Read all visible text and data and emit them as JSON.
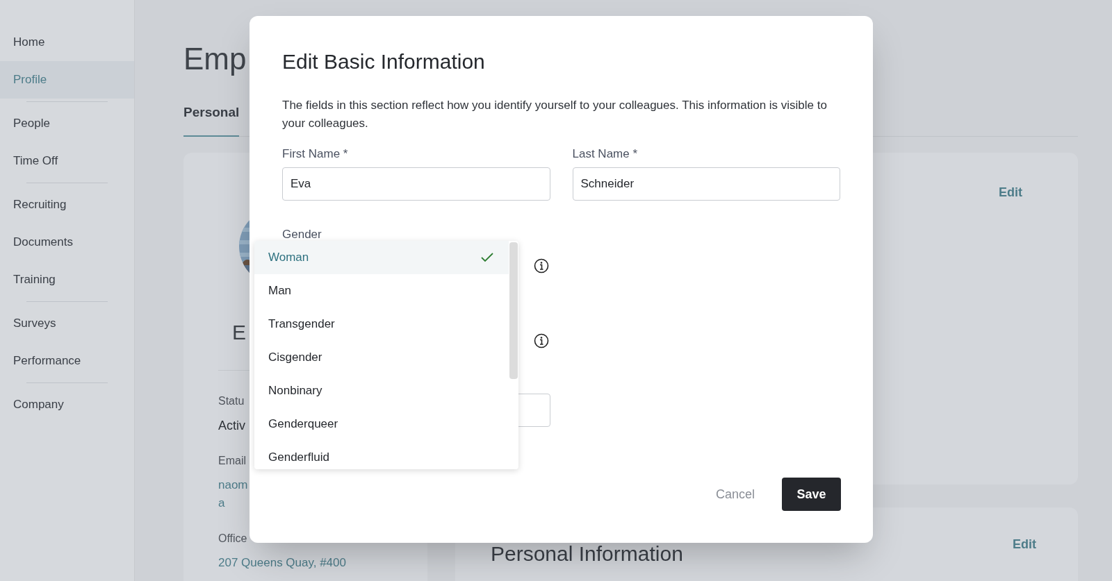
{
  "sidebar": {
    "groups": [
      [
        {
          "label": "Home",
          "selected": false
        },
        {
          "label": "Profile",
          "selected": true
        }
      ],
      [
        {
          "label": "People",
          "selected": false
        },
        {
          "label": "Time Off",
          "selected": false
        }
      ],
      [
        {
          "label": "Recruiting",
          "selected": false
        },
        {
          "label": "Documents",
          "selected": false
        },
        {
          "label": "Training",
          "selected": false
        }
      ],
      [
        {
          "label": "Surveys",
          "selected": false
        },
        {
          "label": "Performance",
          "selected": false
        }
      ],
      [
        {
          "label": "Company",
          "selected": false
        }
      ]
    ]
  },
  "page": {
    "title": "Emp",
    "tabs": [
      {
        "label": "Personal",
        "selected": true
      }
    ],
    "profile_card": {
      "name": "E",
      "fields": [
        {
          "label": "Statu",
          "value": [
            "Activ"
          ],
          "kind": "text"
        },
        {
          "label": "Email",
          "value": [
            "naom",
            "a"
          ],
          "kind": "link"
        },
        {
          "label": "Office",
          "value": [
            "207 Queens Quay, #400"
          ],
          "kind": "link"
        }
      ]
    },
    "cards": [
      {
        "edit": "Edit"
      },
      {
        "title": "Personal Information",
        "edit": "Edit"
      }
    ]
  },
  "modal": {
    "title": "Edit Basic Information",
    "description": "The fields in this section reflect how you identify yourself to your colleagues. This information is visible to your colleagues.",
    "first_name": {
      "label": "First Name *",
      "value": "Eva"
    },
    "last_name": {
      "label": "Last Name *",
      "value": "Schneider"
    },
    "gender": {
      "label": "Gender",
      "options": [
        {
          "label": "Woman",
          "selected": true
        },
        {
          "label": "Man",
          "selected": false
        },
        {
          "label": "Transgender",
          "selected": false
        },
        {
          "label": "Cisgender",
          "selected": false
        },
        {
          "label": "Nonbinary",
          "selected": false
        },
        {
          "label": "Genderqueer",
          "selected": false
        },
        {
          "label": "Genderfluid",
          "selected": false
        }
      ]
    },
    "buttons": {
      "cancel": "Cancel",
      "save": "Save"
    }
  }
}
